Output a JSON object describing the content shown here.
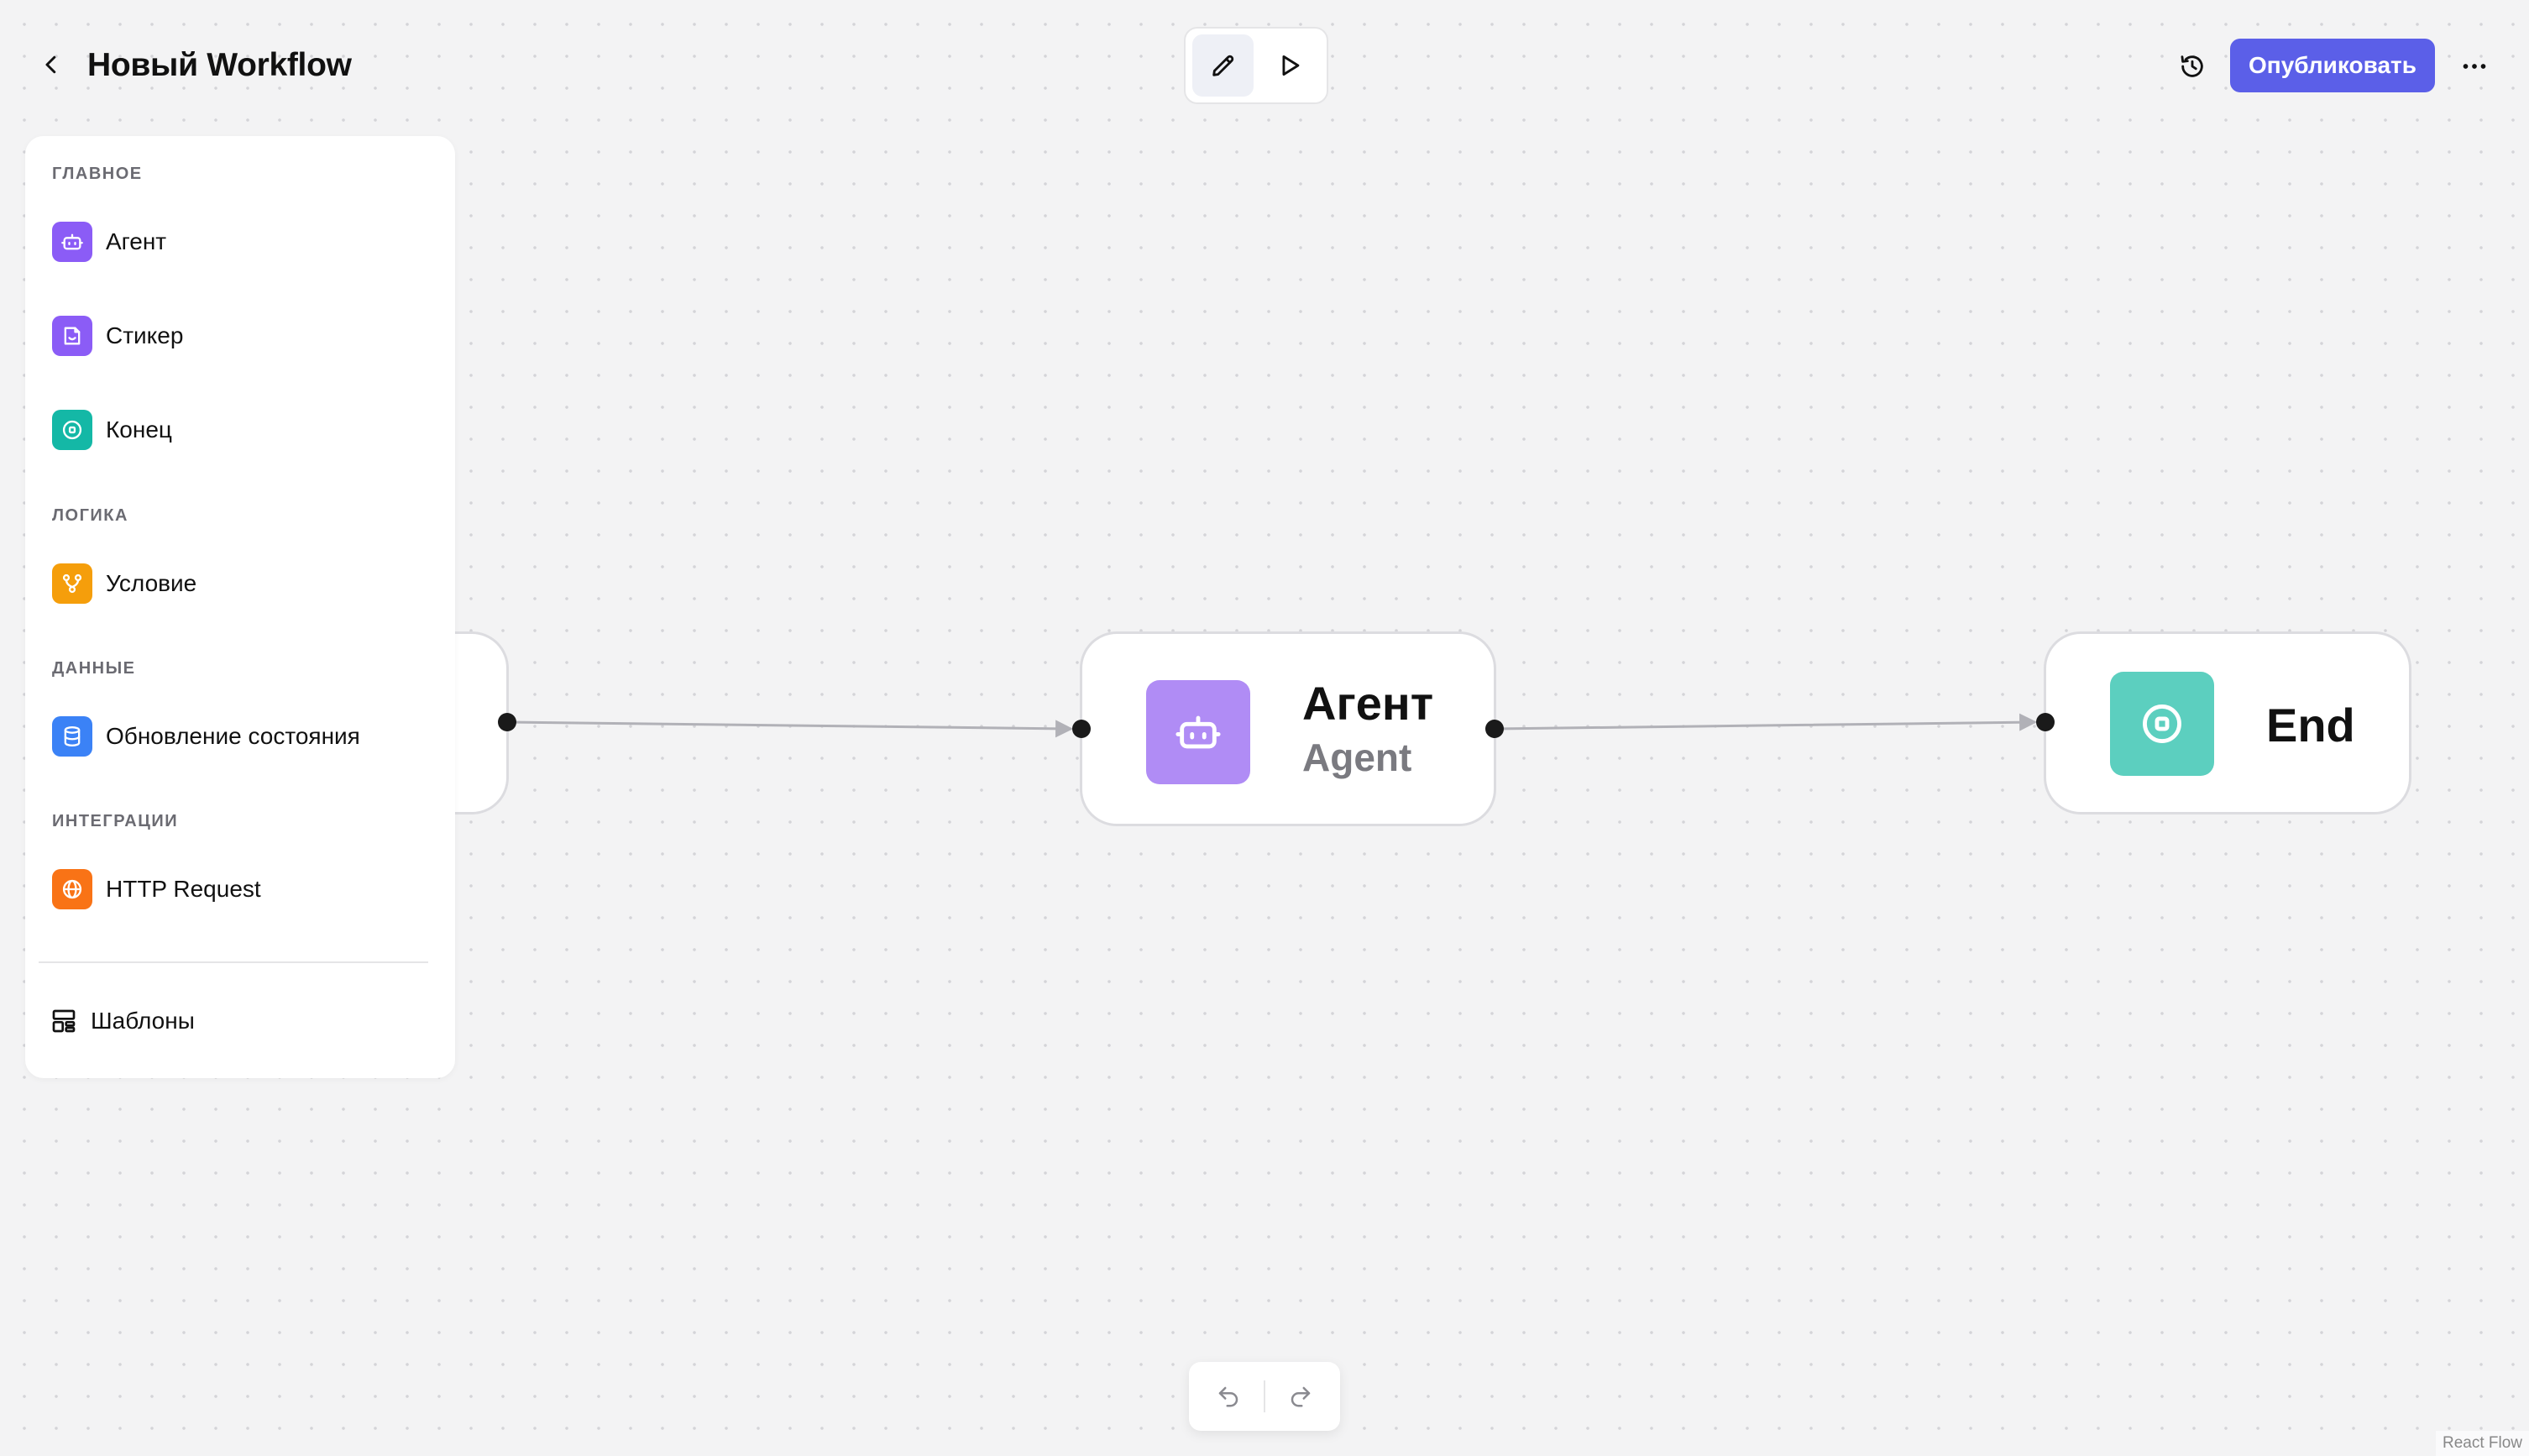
{
  "header": {
    "title": "Новый Workflow",
    "publish_label": "Опубликовать"
  },
  "sidebar": {
    "sections": [
      {
        "label": "ГЛАВНОЕ",
        "items": [
          {
            "label": "Агент",
            "icon": "bot-icon",
            "color": "#8b5cf6"
          },
          {
            "label": "Стикер",
            "icon": "sticker-icon",
            "color": "#8b5cf6"
          },
          {
            "label": "Конец",
            "icon": "stop-circle-icon",
            "color": "#14b8a6"
          }
        ]
      },
      {
        "label": "ЛОГИКА",
        "items": [
          {
            "label": "Условие",
            "icon": "branch-icon",
            "color": "#f59e0b"
          }
        ]
      },
      {
        "label": "ДАННЫЕ",
        "items": [
          {
            "label": "Обновление состояния",
            "icon": "database-icon",
            "color": "#3b82f6"
          }
        ]
      },
      {
        "label": "ИНТЕГРАЦИИ",
        "items": [
          {
            "label": "HTTP Request",
            "icon": "globe-icon",
            "color": "#f97316"
          }
        ]
      }
    ],
    "templates_label": "Шаблоны"
  },
  "canvas": {
    "nodes": [
      {
        "id": "agent",
        "title": "Агент",
        "subtitle": "Agent",
        "icon": "bot-icon",
        "color": "#b08cf5"
      },
      {
        "id": "end",
        "title": "End",
        "icon": "stop-circle-icon",
        "color": "#5ccfbf"
      }
    ]
  },
  "attribution": "React Flow"
}
